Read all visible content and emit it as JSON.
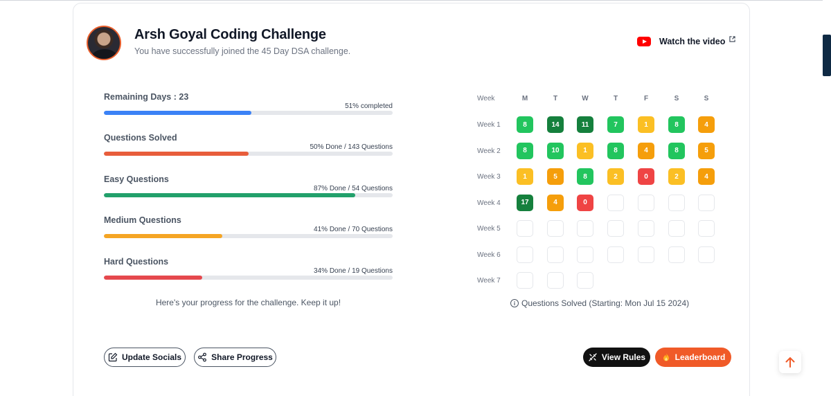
{
  "colors": {
    "blue": "#3b82f6",
    "orange_red": "#e85d3b",
    "green": "#22a06b",
    "amber": "#f5a524",
    "red": "#e5484d",
    "cell_green": "#22c55e",
    "cell_dark_green": "#15803d",
    "cell_yellow": "#fbbf24",
    "cell_amber": "#f59e0b",
    "cell_red": "#ef4444"
  },
  "header": {
    "title": "Arsh Goyal Coding Challenge",
    "subtitle": "You have successfully joined the 45 Day DSA challenge.",
    "watch_video_label": "Watch the video",
    "youtube_icon": "youtube-icon",
    "external_icon": "external-link-icon"
  },
  "stats": [
    {
      "label": "Remaining Days : 23",
      "right": "51% completed",
      "progress": 0.51,
      "color": "#3b82f6"
    },
    {
      "label": "Questions Solved",
      "right": "50% Done / 143 Questions",
      "progress": 0.5,
      "color": "#e85d3b"
    },
    {
      "label": "Easy Questions",
      "right": "87% Done / 54 Questions",
      "progress": 0.87,
      "color": "#22a06b"
    },
    {
      "label": "Medium Questions",
      "right": "41% Done / 70 Questions",
      "progress": 0.41,
      "color": "#f5a524"
    },
    {
      "label": "Hard Questions",
      "right": "34% Done / 19 Questions",
      "progress": 0.34,
      "color": "#e5484d"
    }
  ],
  "encourage_text": "Here's your progress for the challenge. Keep it up!",
  "calendar": {
    "week_header": "Week",
    "days": [
      "M",
      "T",
      "W",
      "T",
      "F",
      "S",
      "S"
    ],
    "weeks": [
      {
        "label": "Week 1",
        "cells": [
          {
            "v": "8",
            "c": "#22c55e"
          },
          {
            "v": "14",
            "c": "#15803d"
          },
          {
            "v": "11",
            "c": "#15803d"
          },
          {
            "v": "7",
            "c": "#22c55e"
          },
          {
            "v": "1",
            "c": "#fbbf24"
          },
          {
            "v": "8",
            "c": "#22c55e"
          },
          {
            "v": "4",
            "c": "#f59e0b"
          }
        ]
      },
      {
        "label": "Week 2",
        "cells": [
          {
            "v": "8",
            "c": "#22c55e"
          },
          {
            "v": "10",
            "c": "#22c55e"
          },
          {
            "v": "1",
            "c": "#fbbf24"
          },
          {
            "v": "8",
            "c": "#22c55e"
          },
          {
            "v": "4",
            "c": "#f59e0b"
          },
          {
            "v": "8",
            "c": "#22c55e"
          },
          {
            "v": "5",
            "c": "#f59e0b"
          }
        ]
      },
      {
        "label": "Week 3",
        "cells": [
          {
            "v": "1",
            "c": "#fbbf24"
          },
          {
            "v": "5",
            "c": "#f59e0b"
          },
          {
            "v": "8",
            "c": "#22c55e"
          },
          {
            "v": "2",
            "c": "#fbbf24"
          },
          {
            "v": "0",
            "c": "#ef4444"
          },
          {
            "v": "2",
            "c": "#fbbf24"
          },
          {
            "v": "4",
            "c": "#f59e0b"
          }
        ]
      },
      {
        "label": "Week 4",
        "cells": [
          {
            "v": "17",
            "c": "#15803d"
          },
          {
            "v": "4",
            "c": "#f59e0b"
          },
          {
            "v": "0",
            "c": "#ef4444"
          },
          {
            "v": "",
            "c": ""
          },
          {
            "v": "",
            "c": ""
          },
          {
            "v": "",
            "c": ""
          },
          {
            "v": "",
            "c": ""
          }
        ]
      },
      {
        "label": "Week 5",
        "cells": [
          {
            "v": "",
            "c": ""
          },
          {
            "v": "",
            "c": ""
          },
          {
            "v": "",
            "c": ""
          },
          {
            "v": "",
            "c": ""
          },
          {
            "v": "",
            "c": ""
          },
          {
            "v": "",
            "c": ""
          },
          {
            "v": "",
            "c": ""
          }
        ]
      },
      {
        "label": "Week 6",
        "cells": [
          {
            "v": "",
            "c": ""
          },
          {
            "v": "",
            "c": ""
          },
          {
            "v": "",
            "c": ""
          },
          {
            "v": "",
            "c": ""
          },
          {
            "v": "",
            "c": ""
          },
          {
            "v": "",
            "c": ""
          },
          {
            "v": "",
            "c": ""
          }
        ]
      },
      {
        "label": "Week 7",
        "cells": [
          {
            "v": "",
            "c": ""
          },
          {
            "v": "",
            "c": ""
          },
          {
            "v": "",
            "c": ""
          }
        ]
      }
    ],
    "legend": "Questions Solved (Starting: Mon Jul 15 2024)"
  },
  "buttons": {
    "update_socials": "Update Socials",
    "share_progress": "Share Progress",
    "view_rules": "View Rules",
    "leaderboard": "Leaderboard"
  }
}
